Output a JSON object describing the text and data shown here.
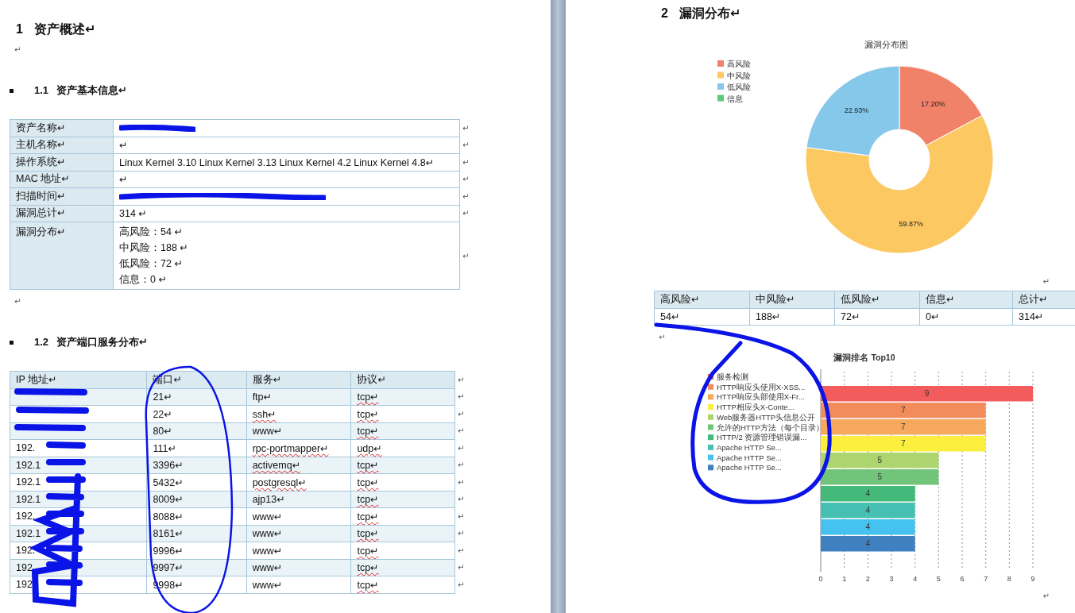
{
  "left_page": {
    "blocks": [
      {
        "kind": "heading1",
        "number": "1",
        "text": "资产概述↵"
      },
      {
        "kind": "mark",
        "text": "↵"
      },
      {
        "kind": "heading2",
        "number": "1.1",
        "text": "资产基本信息↵"
      },
      {
        "kind": "kv_table",
        "end_mark": "↵",
        "rows": [
          {
            "label": "资产名称↵",
            "redacted": true
          },
          {
            "label": "主机名称↵",
            "redacted": false,
            "values": [
              "↵"
            ]
          },
          {
            "label": "操作系统↵",
            "redacted": false,
            "values": [
              "Linux Kernel 3.10 Linux Kernel 3.13 Linux Kernel 4.2 Linux Kernel 4.8↵"
            ]
          },
          {
            "label": "MAC 地址↵",
            "redacted": false,
            "values": [
              "↵"
            ]
          },
          {
            "label": "扫描时间↵",
            "redacted": true
          },
          {
            "label": "漏洞总计↵",
            "redacted": false,
            "values": [
              "314 ↵"
            ]
          },
          {
            "label": "漏洞分布↵",
            "redacted": false,
            "values": [
              "高风险：54 ↵",
              "中风险：188 ↵",
              "低风险：72 ↵",
              "信息：0 ↵"
            ]
          }
        ]
      },
      {
        "kind": "mark",
        "text": "↵"
      },
      {
        "kind": "heading2",
        "number": "1.2",
        "text": "资产端口服务分布↵"
      },
      {
        "kind": "port_table",
        "end_mark": "↵",
        "columns": [
          "IP 地址↵",
          "端口↵",
          "服务↵",
          "协议↵"
        ],
        "rows": [
          {
            "port": "21↵",
            "service": "ftp↵",
            "service_flagged": false,
            "protocol": "tcp↵",
            "protocol_flagged": true
          },
          {
            "port": "22↵",
            "service": "ssh↵",
            "service_flagged": true,
            "protocol": "tcp↵",
            "protocol_flagged": true
          },
          {
            "port": "80↵",
            "service": "www↵",
            "service_flagged": false,
            "protocol": "tcp↵",
            "protocol_flagged": true
          },
          {
            "ip": "192.",
            "port": "111↵",
            "service": "rpc-portmapper↵",
            "service_flagged": true,
            "protocol": "udp↵",
            "protocol_flagged": true
          },
          {
            "ip": "192.1",
            "port": "3396↵",
            "service": "activemq↵",
            "service_flagged": true,
            "protocol": "tcp↵",
            "protocol_flagged": true
          },
          {
            "ip": "192.1",
            "port": "5432↵",
            "service": "postgresql↵",
            "service_flagged": true,
            "protocol": "tcp↵",
            "protocol_flagged": true
          },
          {
            "ip": "192.1",
            "port": "8009↵",
            "service": "ajp13↵",
            "service_flagged": false,
            "protocol": "tcp↵",
            "protocol_flagged": true
          },
          {
            "ip": "192.",
            "port": "8088↵",
            "service": "www↵",
            "service_flagged": false,
            "protocol": "tcp↵",
            "protocol_flagged": true
          },
          {
            "ip": "192.1",
            "port": "8161↵",
            "service": "www↵",
            "service_flagged": false,
            "protocol": "tcp↵",
            "protocol_flagged": true
          },
          {
            "ip": "192.",
            "port": "9996↵",
            "service": "www↵",
            "service_flagged": false,
            "protocol": "tcp↵",
            "protocol_flagged": true
          },
          {
            "ip": "192",
            "port": "9997↵",
            "service": "www↵",
            "service_flagged": false,
            "protocol": "tcp↵",
            "protocol_flagged": true
          },
          {
            "ip": "192",
            "port": "9998↵",
            "service": "www↵",
            "service_flagged": false,
            "protocol": "tcp↵",
            "protocol_flagged": true
          }
        ]
      }
    ]
  },
  "right_page": {
    "blocks": [
      {
        "kind": "heading1",
        "number": "2",
        "text": "漏洞分布↵"
      },
      {
        "kind": "chart",
        "chart_data": {
          "type": "donut",
          "title": "漏洞分布图",
          "legend": "upper left",
          "categories": [
            "高风险",
            "中风险",
            "低风险",
            "信息"
          ],
          "colors": [
            "#f0826a",
            "#fcc862",
            "#86c8ea",
            "#5cc97a"
          ],
          "series": [
            {
              "values": [
                17.2,
                59.87,
                22.93,
                0
              ]
            }
          ],
          "value_labels": [
            "17.20%",
            "59.87%",
            "22.93%",
            null
          ]
        }
      },
      {
        "kind": "mark_right",
        "text": "↵"
      },
      {
        "kind": "summary_table",
        "columns": [
          "高风险↵",
          "中风险↵",
          "低风险↵",
          "信息↵",
          "总计↵"
        ],
        "values": [
          "54↵",
          "188↵",
          "72↵",
          "0↵",
          "314↵"
        ]
      },
      {
        "kind": "mark",
        "text": "↵"
      },
      {
        "kind": "chart",
        "chart_data": {
          "type": "bar",
          "orientation": "horizontal",
          "title": "漏洞排名 Top10",
          "legend": "upper left",
          "grid": true,
          "series": [
            {
              "name": "服务检测",
              "color": "#f25c5c",
              "values": [
                9
              ]
            },
            {
              "name": "HTTP响应头使用X-XSS...",
              "color": "#f38c5c",
              "values": [
                7
              ]
            },
            {
              "name": "HTTP响应头部使用X-Fr...",
              "color": "#f6a85c",
              "values": [
                7
              ]
            },
            {
              "name": "HTTP相应头X-Conte...",
              "color": "#fcee3c",
              "values": [
                7
              ]
            },
            {
              "name": "Web服务器HTTP头信息公开",
              "color": "#acd56f",
              "values": [
                5
              ]
            },
            {
              "name": "允许的HTTP方法（每个目录）",
              "color": "#72c47a",
              "values": [
                5
              ]
            },
            {
              "name": "HTTP/2 资源管理错误漏...",
              "color": "#44b97a",
              "values": [
                4
              ]
            },
            {
              "name": "Apache HTTP Se...",
              "color": "#45c0b2",
              "values": [
                4
              ]
            },
            {
              "name": "Apache HTTP Se...",
              "color": "#46c2f0",
              "values": [
                4
              ]
            },
            {
              "name": "Apache HTTP Se...",
              "color": "#3f80c0",
              "values": [
                4
              ]
            }
          ],
          "xlim": [
            0,
            9
          ],
          "xticks": [
            0,
            1,
            2,
            3,
            4,
            5,
            6,
            7,
            8,
            9
          ],
          "data_labels": true
        }
      },
      {
        "kind": "mark_right",
        "text": "↵"
      }
    ]
  }
}
